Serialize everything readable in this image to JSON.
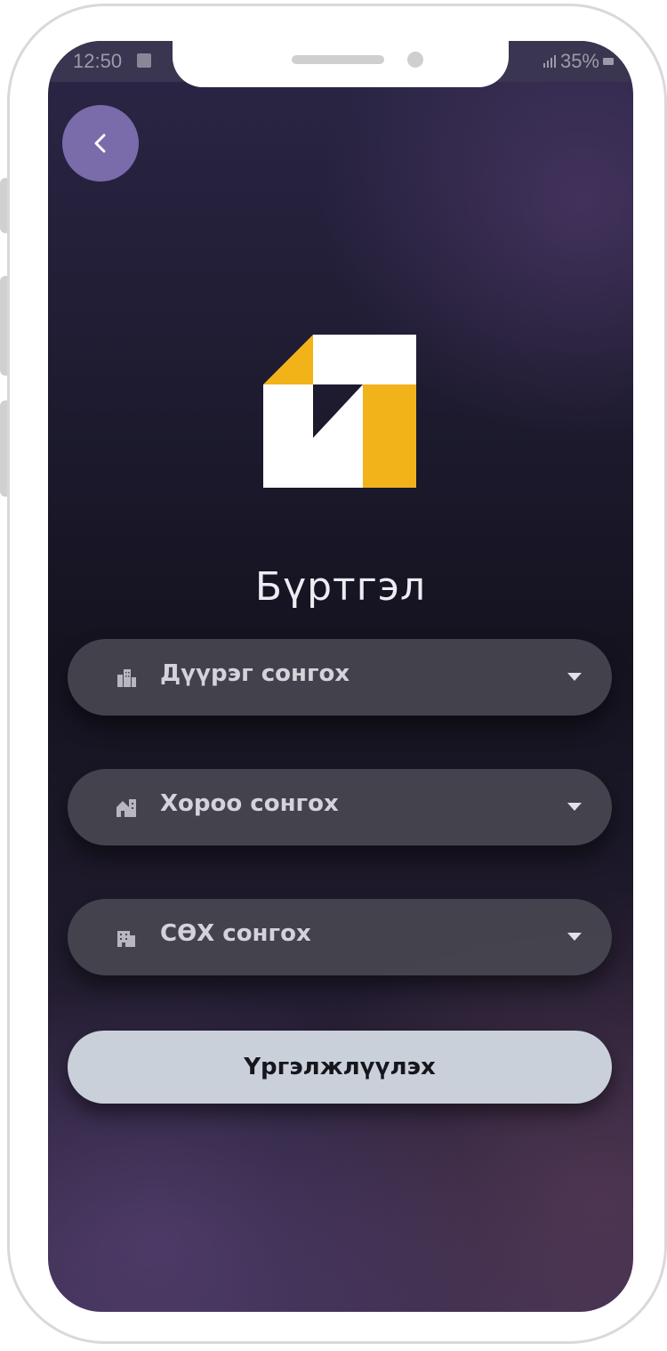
{
  "status_bar": {
    "time": "12:50",
    "battery": "35%"
  },
  "header": {
    "back_icon": "chevron-left-icon"
  },
  "page": {
    "title": "Бүртгэл"
  },
  "colors": {
    "logo_yellow": "#F2B21A",
    "logo_white": "#FFFFFF",
    "back_button": "#7A6BAB",
    "continue_button": "#C9D0DA"
  },
  "form": {
    "fields": [
      {
        "label": "Дүүрэг сонгох",
        "icon": "city-icon"
      },
      {
        "label": "Хороо сонгох",
        "icon": "house-icon"
      },
      {
        "label": "СӨХ сонгох",
        "icon": "apartment-icon"
      }
    ],
    "continue_label": "Үргэлжлүүлэх"
  }
}
